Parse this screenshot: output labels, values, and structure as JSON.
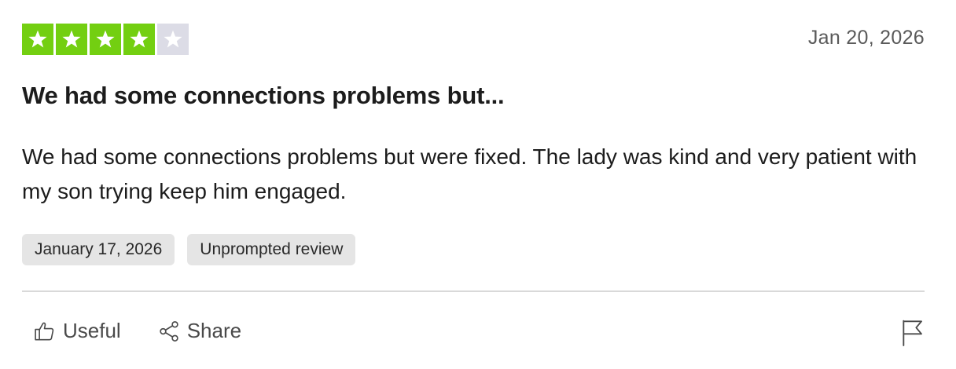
{
  "review": {
    "rating": 4,
    "rating_max": 5,
    "date": "Jan 20, 2026",
    "title": "We had some connections problems but...",
    "body": "We had some connections problems but were fixed. The lady was kind and very patient with my son trying keep him engaged.",
    "tags": {
      "experience_date": "January 17, 2026",
      "source": "Unprompted review"
    }
  },
  "actions": {
    "useful_label": "Useful",
    "share_label": "Share"
  },
  "colors": {
    "star_filled": "#73cf11",
    "star_empty": "#dcdce6",
    "chip_bg": "#e5e5e5",
    "divider": "#d9d9d9"
  },
  "icons": {
    "useful": "thumbs-up-icon",
    "share": "share-icon",
    "report": "flag-icon"
  }
}
